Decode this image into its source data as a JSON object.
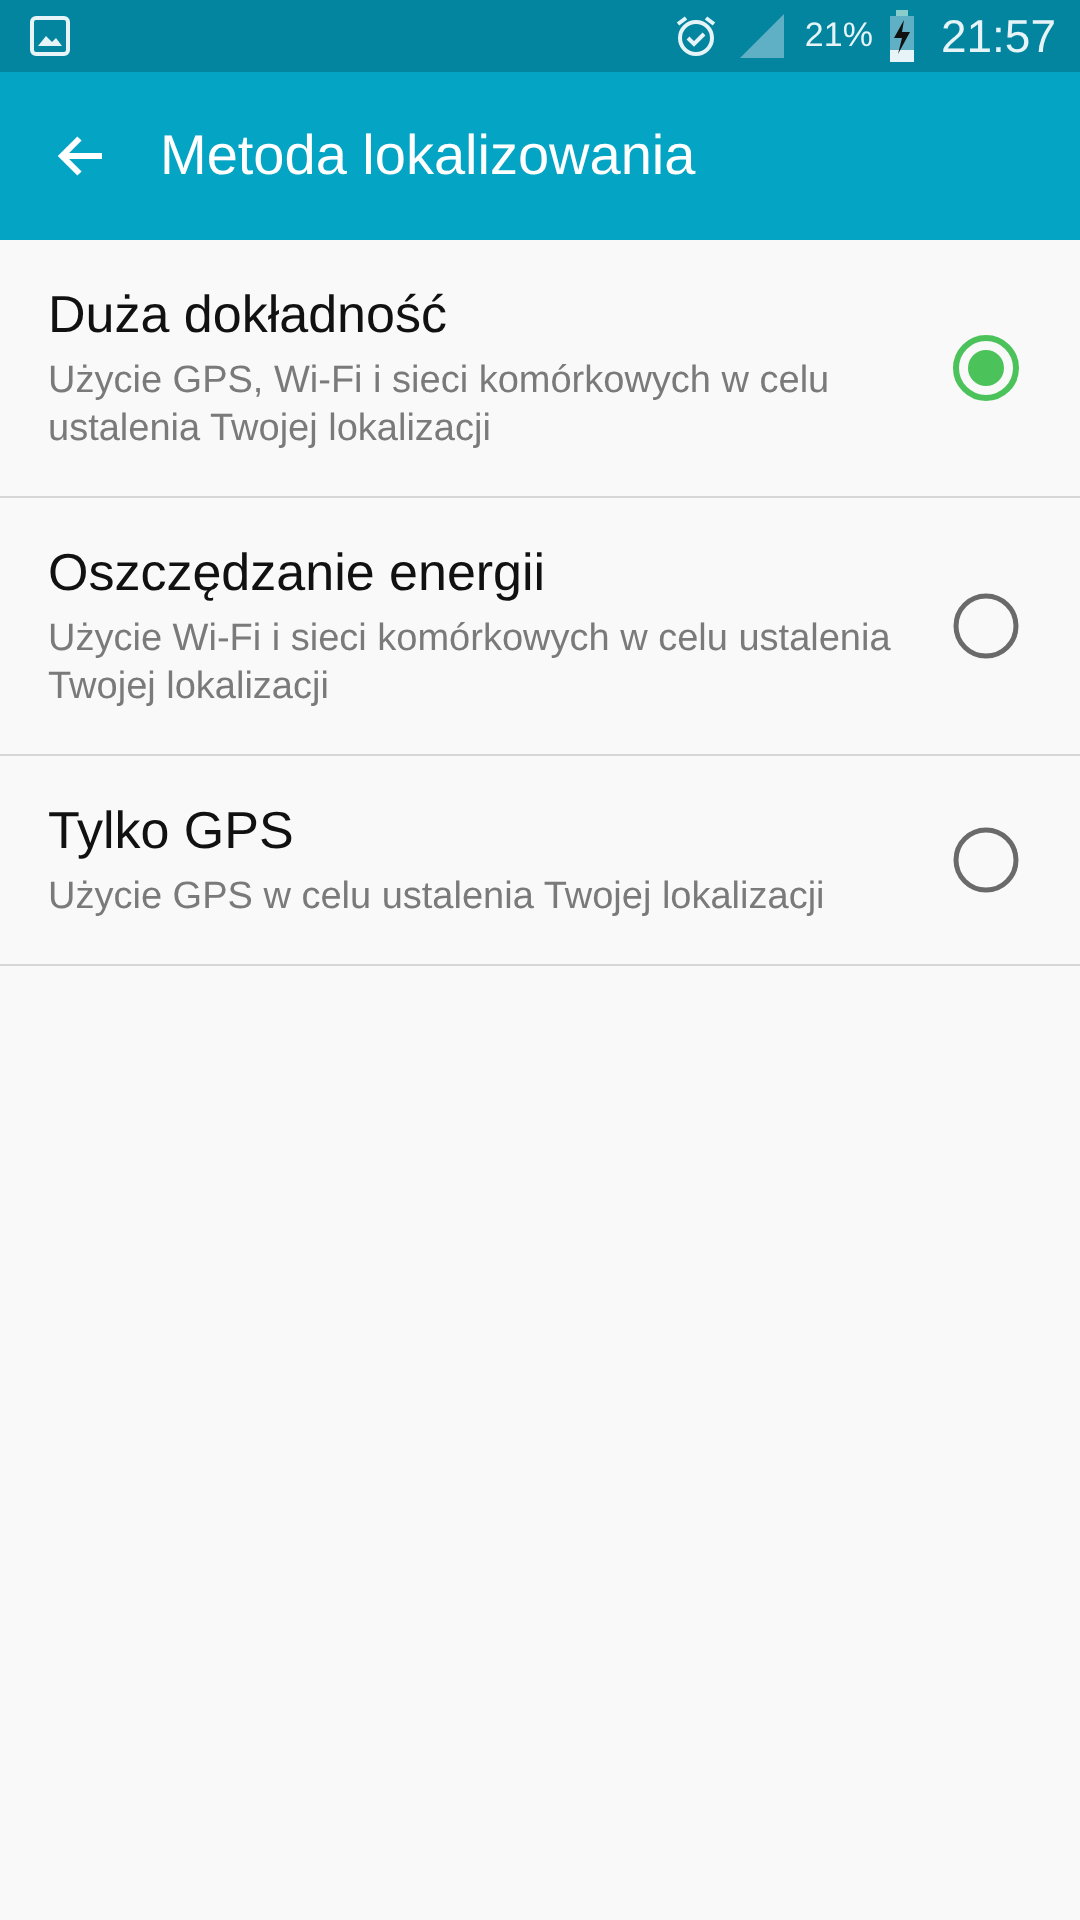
{
  "status_bar": {
    "battery": "21%",
    "time": "21:57"
  },
  "app_bar": {
    "title": "Metoda lokalizowania"
  },
  "options": [
    {
      "title": "Duża dokładność",
      "description": "Użycie GPS, Wi-Fi i sieci komórkowych w celu ustalenia Twojej lokalizacji",
      "selected": true
    },
    {
      "title": "Oszczędzanie energii",
      "description": "Użycie Wi-Fi i sieci komórkowych w celu ustalenia Twojej lokalizacji",
      "selected": false
    },
    {
      "title": "Tylko GPS",
      "description": "Użycie GPS w celu ustalenia Twojej lokalizacji",
      "selected": false
    }
  ]
}
